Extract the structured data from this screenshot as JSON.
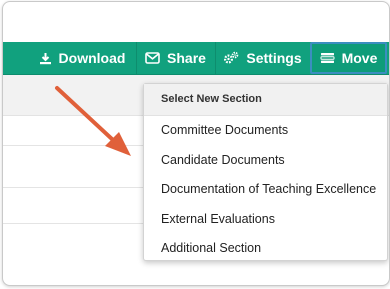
{
  "toolbar": {
    "background": "#11a17e",
    "buttons": [
      {
        "label": "Download",
        "icon": "download-icon"
      },
      {
        "label": "Share",
        "icon": "envelope-icon"
      },
      {
        "label": "Settings",
        "icon": "gears-icon"
      },
      {
        "label": "Move",
        "icon": "list-icon",
        "active": true
      }
    ]
  },
  "dropdown": {
    "header": "Select New Section",
    "items": [
      "Committee Documents",
      "Candidate Documents",
      "Documentation of Teaching Excellence",
      "External Evaluations",
      "Additional Section"
    ]
  },
  "annotation": {
    "arrow_color": "#e0603a"
  }
}
